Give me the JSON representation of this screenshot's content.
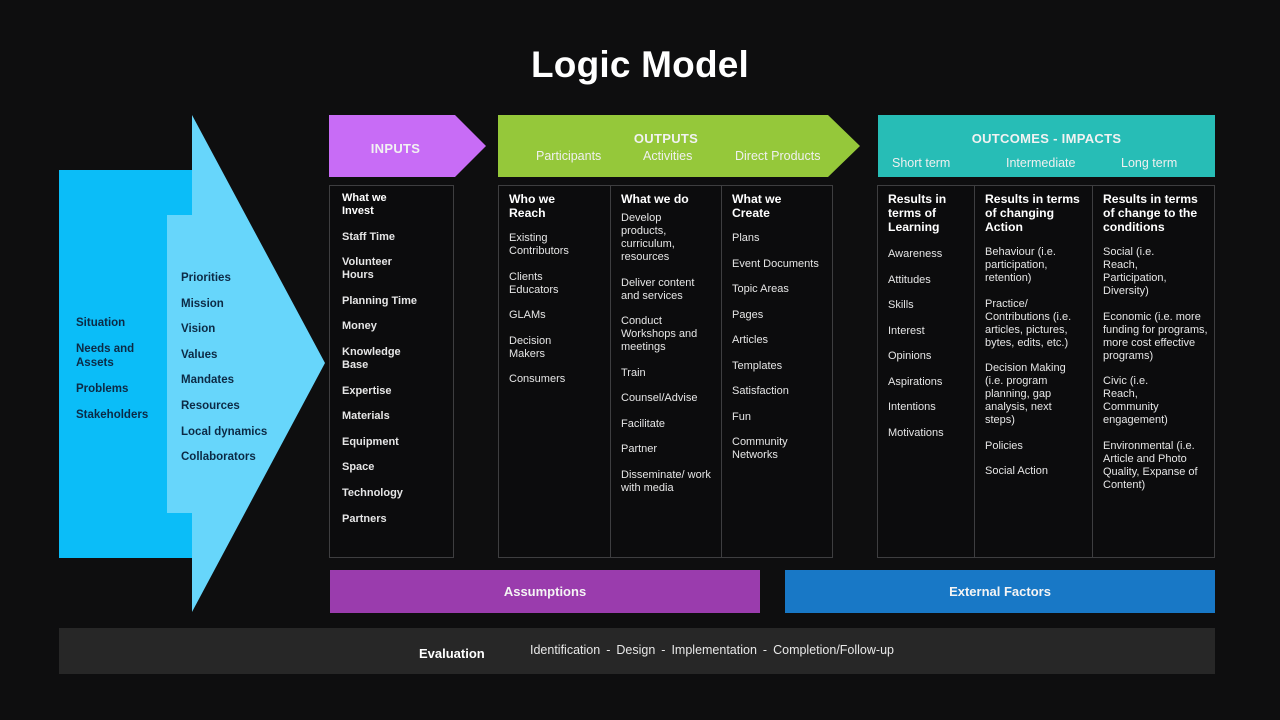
{
  "title": "Logic Model",
  "colors": {
    "background": "#0e0e0f",
    "situation_block": "#0bbdf8",
    "priorities_arrow": "#67d6fb",
    "inputs": "#c86cf6",
    "outputs": "#95c83a",
    "outcomes": "#27bdb6",
    "assumptions": "#9a3cad",
    "external_factors": "#1878c6",
    "evaluation_bar": "#272727"
  },
  "situation": {
    "items": [
      "Situation",
      "Needs and Assets",
      "Problems",
      "Stakeholders"
    ]
  },
  "priorities": {
    "items": [
      "Priorities",
      "Mission",
      "Vision",
      "Values",
      "Mandates",
      "Resources",
      "Local dynamics",
      "Collaborators"
    ]
  },
  "inputs": {
    "title": "INPUTS",
    "heading": "What we Invest",
    "items": [
      "Staff Time",
      "Volunteer Hours",
      "Planning Time",
      "Money",
      "Knowledge Base",
      "Expertise",
      "Materials",
      "Equipment",
      "Space",
      "Technology",
      "Partners"
    ]
  },
  "outputs": {
    "title": "OUTPUTS",
    "subtitles": [
      "Participants",
      "Activities",
      "Direct Products"
    ],
    "columns": [
      {
        "heading": "Who we Reach",
        "items": [
          "Existing Contributors",
          "Clients Educators",
          "GLAMs",
          "Decision Makers",
          "Consumers"
        ]
      },
      {
        "heading": "What we do",
        "items": [
          "Develop products, curriculum, resources",
          "Deliver content and services",
          "Conduct Workshops and meetings",
          "Train",
          "Counsel/Advise",
          "Facilitate",
          "Partner",
          "Disseminate/ work with media"
        ]
      },
      {
        "heading": "What we Create",
        "items": [
          "Plans",
          "Event Documents",
          "Topic Areas",
          "Pages",
          "Articles",
          "Templates",
          "Satisfaction",
          "Fun",
          "Community Networks"
        ]
      }
    ]
  },
  "outcomes": {
    "title": "OUTCOMES - IMPACTS",
    "subtitles": [
      "Short term",
      "Intermediate",
      "Long term"
    ],
    "columns": [
      {
        "heading": "Results in terms of Learning",
        "items": [
          "Awareness",
          "Attitudes",
          "Skills",
          "Interest",
          "Opinions",
          "Aspirations",
          "Intentions",
          "Motivations"
        ]
      },
      {
        "heading": "Results in terms of changing Action",
        "items": [
          "Behaviour (i.e. participation, retention)",
          "Practice/ Contributions (i.e. articles, pictures, bytes, edits, etc.)",
          "Decision Making (i.e. program planning, gap analysis, next steps)",
          "Policies",
          "Social Action"
        ]
      },
      {
        "heading": "Results in terms of change to the conditions",
        "items": [
          "Social (i.e. Reach, Participation, Diversity)",
          "Economic (i.e. more funding for programs, more cost effective programs)",
          "Civic (i.e. Reach, Community engagement)",
          "Environmental (i.e. Article and Photo Quality, Expanse of Content)"
        ]
      }
    ]
  },
  "assumptions": {
    "label": "Assumptions"
  },
  "external_factors": {
    "label": "External Factors"
  },
  "evaluation": {
    "label": "Evaluation",
    "steps": [
      "Identification",
      "Design",
      "Implementation",
      "Completion/Follow-up"
    ],
    "separator": "-"
  }
}
